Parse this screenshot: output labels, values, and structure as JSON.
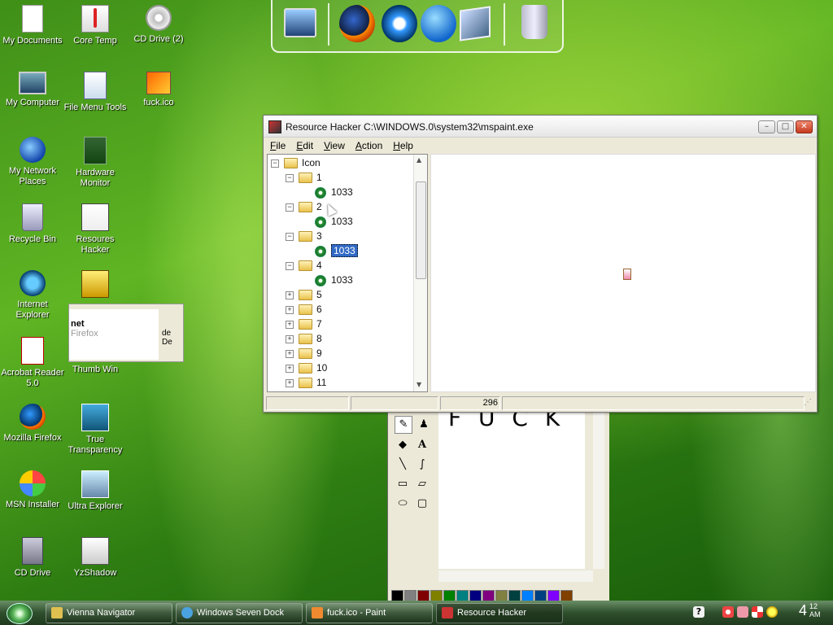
{
  "desktop_icons": [
    {
      "label": "My Documents",
      "icon": "document-icon"
    },
    {
      "label": "Core Temp",
      "icon": "thermometer-icon"
    },
    {
      "label": "CD Drive (2)",
      "icon": "cd-drive-icon"
    },
    {
      "label": "My Computer",
      "icon": "computer-icon"
    },
    {
      "label": "File Menu Tools",
      "icon": "files-icon"
    },
    {
      "label": "fuck.ico",
      "icon": "image-file-icon"
    },
    {
      "label": "My Network Places",
      "icon": "network-icon"
    },
    {
      "label": "Hardware Monitor",
      "icon": "hardware-icon"
    },
    {
      "label": "Recycle Bin",
      "icon": "recycle-bin-icon"
    },
    {
      "label": "Resoures Hacker",
      "icon": "resource-hacker-icon"
    },
    {
      "label": "Internet Explorer",
      "icon": "internet-explorer-icon"
    },
    {
      "label": "Acrobat Reader 5.0",
      "icon": "acrobat-icon"
    },
    {
      "label": "Thumb Win",
      "icon": "thumb-win-icon"
    },
    {
      "label": "Mozilla Firefox",
      "icon": "firefox-icon"
    },
    {
      "label": "True Transparency",
      "icon": "true-transparency-icon"
    },
    {
      "label": "MSN Installer",
      "icon": "msn-icon"
    },
    {
      "label": "Ultra Explorer",
      "icon": "ultra-explorer-icon"
    },
    {
      "label": "CD Drive",
      "icon": "cd-drive-icon"
    },
    {
      "label": "YzShadow",
      "icon": "yzshadow-icon"
    }
  ],
  "ghost_window": {
    "line1": "net",
    "line2": "Firefox",
    "side": "de De"
  },
  "dock_items": [
    "monitor-icon",
    "firefox-icon",
    "internet-explorer-icon",
    "media-player-icon",
    "picture-viewer-icon",
    "recycle-bin-icon"
  ],
  "resource_hacker": {
    "title": "Resource Hacker   C:\\WINDOWS.0\\system32\\mspaint.exe",
    "menu": [
      "File",
      "Edit",
      "View",
      "Action",
      "Help"
    ],
    "tree": {
      "root": "Icon",
      "groups": [
        {
          "name": "1",
          "expanded": true,
          "child": "1033"
        },
        {
          "name": "2",
          "expanded": true,
          "child": "1033"
        },
        {
          "name": "3",
          "expanded": true,
          "child": "1033",
          "selected": true
        },
        {
          "name": "4",
          "expanded": true,
          "child": "1033"
        },
        {
          "name": "5",
          "expanded": false
        },
        {
          "name": "6",
          "expanded": false
        },
        {
          "name": "7",
          "expanded": false
        },
        {
          "name": "8",
          "expanded": false
        },
        {
          "name": "9",
          "expanded": false
        },
        {
          "name": "10",
          "expanded": false
        },
        {
          "name": "11",
          "expanded": false
        }
      ]
    },
    "status": {
      "panel1": "",
      "panel2": "",
      "panel3": "296",
      "panel4": ""
    },
    "window_buttons": {
      "minimize": "–",
      "maximize": "□",
      "close": "✕"
    }
  },
  "paint": {
    "canvas_text": "F U C K"
  },
  "taskbar": {
    "buttons": [
      {
        "label": "Vienna Navigator",
        "color": "#e0c050"
      },
      {
        "label": "Windows Seven Dock",
        "color": "#4aa3df"
      },
      {
        "label": "fuck.ico - Paint",
        "color": "#f08a30"
      },
      {
        "label": "Resource Hacker",
        "color": "#c33",
        "active": true
      }
    ],
    "clock": {
      "hour": "4",
      "minute": "12",
      "ampm": "AM"
    }
  },
  "colors": {
    "selection": "#316ac5",
    "taskbar": "#2f4f2d"
  }
}
